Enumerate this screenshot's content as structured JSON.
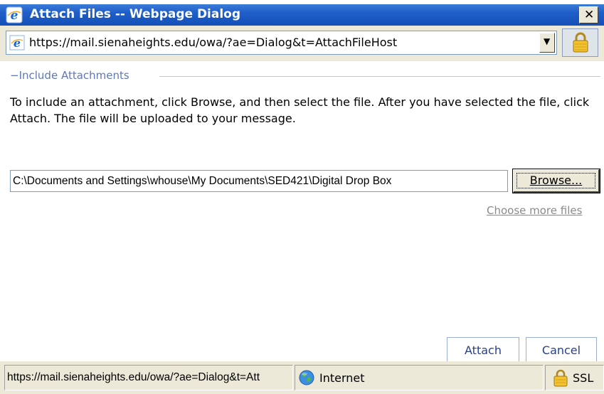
{
  "window": {
    "title": "Attach Files -- Webpage Dialog",
    "close_glyph": "✕"
  },
  "address": {
    "url": "https://mail.sienaheights.edu/owa/?ae=Dialog&t=AttachFileHost",
    "dropdown_glyph": "▼"
  },
  "section": {
    "legend": "Include Attachments",
    "instructions": "To include an attachment, click Browse, and then select the file. After you have selected the file, click Attach. The file will be uploaded to your message."
  },
  "file_input": {
    "value": "C:\\Documents and Settings\\whouse\\My Documents\\SED421\\Digital Drop Box"
  },
  "buttons": {
    "browse": "Browse...",
    "choose_more": "Choose more files",
    "attach": "Attach",
    "cancel": "Cancel"
  },
  "status": {
    "url": "https://mail.sienaheights.edu/owa/?ae=Dialog&t=Att",
    "zone": "Internet",
    "security": "SSL"
  },
  "icons": {
    "ie": "ie-logo-icon",
    "lock": "padlock-icon",
    "globe": "globe-icon"
  },
  "colors": {
    "titlebar": "#1f5ec8",
    "legend": "#6078b8",
    "button_text": "#27408b",
    "disabled_link": "#8a8a8a"
  }
}
